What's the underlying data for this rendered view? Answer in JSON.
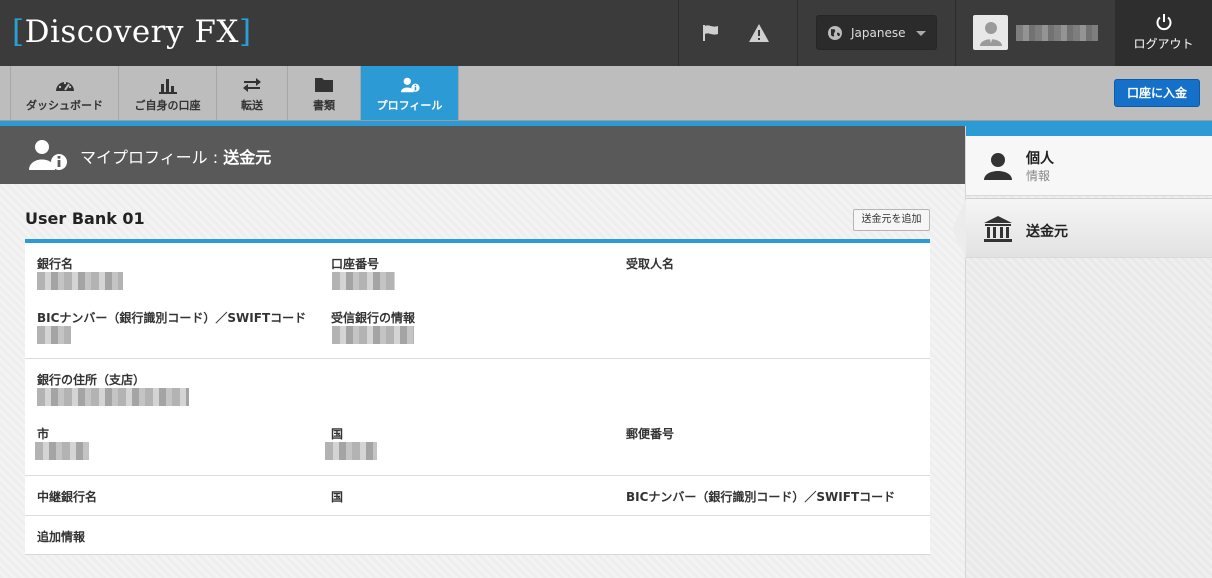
{
  "header": {
    "logo_name": "Discovery FX",
    "logo_bracket_open": "[",
    "logo_bracket_close": "]",
    "language": "Japanese",
    "logout_label": "ログアウト",
    "icons": [
      "flag-icon",
      "warning-icon",
      "globe-icon",
      "user-avatar-icon",
      "power-icon"
    ]
  },
  "nav": {
    "tabs": [
      {
        "label": "ダッシュボード",
        "icon": "dashboard-gauge-icon"
      },
      {
        "label": "ご自身の口座",
        "icon": "bar-chart-icon"
      },
      {
        "label": "転送",
        "icon": "transfer-arrows-icon"
      },
      {
        "label": "書類",
        "icon": "folder-icon"
      },
      {
        "label": "プロフィール",
        "icon": "profile-info-icon",
        "active": true
      }
    ],
    "deposit_label": "口座に入金"
  },
  "title": {
    "prefix": "マイプロフィール : ",
    "section": "送金元"
  },
  "bank": {
    "name": "User Bank 01",
    "add_label": "送金元を追加",
    "fields": {
      "bank_name": "銀行名",
      "account_number": "口座番号",
      "recipient_name": "受取人名",
      "bic_swift": "BICナンバー（銀行識別コード）／SWIFTコード",
      "receiving_bank_info": "受信銀行の情報",
      "bank_address": "銀行の住所（支店）",
      "city": "市",
      "country": "国",
      "postal_code": "郵便番号",
      "intermediary_bank_name": "中継銀行名",
      "intermediary_country": "国",
      "intermediary_bic_swift": "BICナンバー（銀行識別コード）／SWIFTコード",
      "additional_info": "追加情報"
    }
  },
  "sidebar": {
    "items": [
      {
        "main": "個人",
        "sub": "情報",
        "icon": "person-icon"
      },
      {
        "main": "送金元",
        "sub": "",
        "icon": "bank-icon",
        "active": true
      }
    ]
  },
  "colors": {
    "accent": "#2c9ad4",
    "header_bg": "#3b3b3b",
    "nav_bg": "#bdbdbd",
    "deposit_button": "#1470c8"
  }
}
